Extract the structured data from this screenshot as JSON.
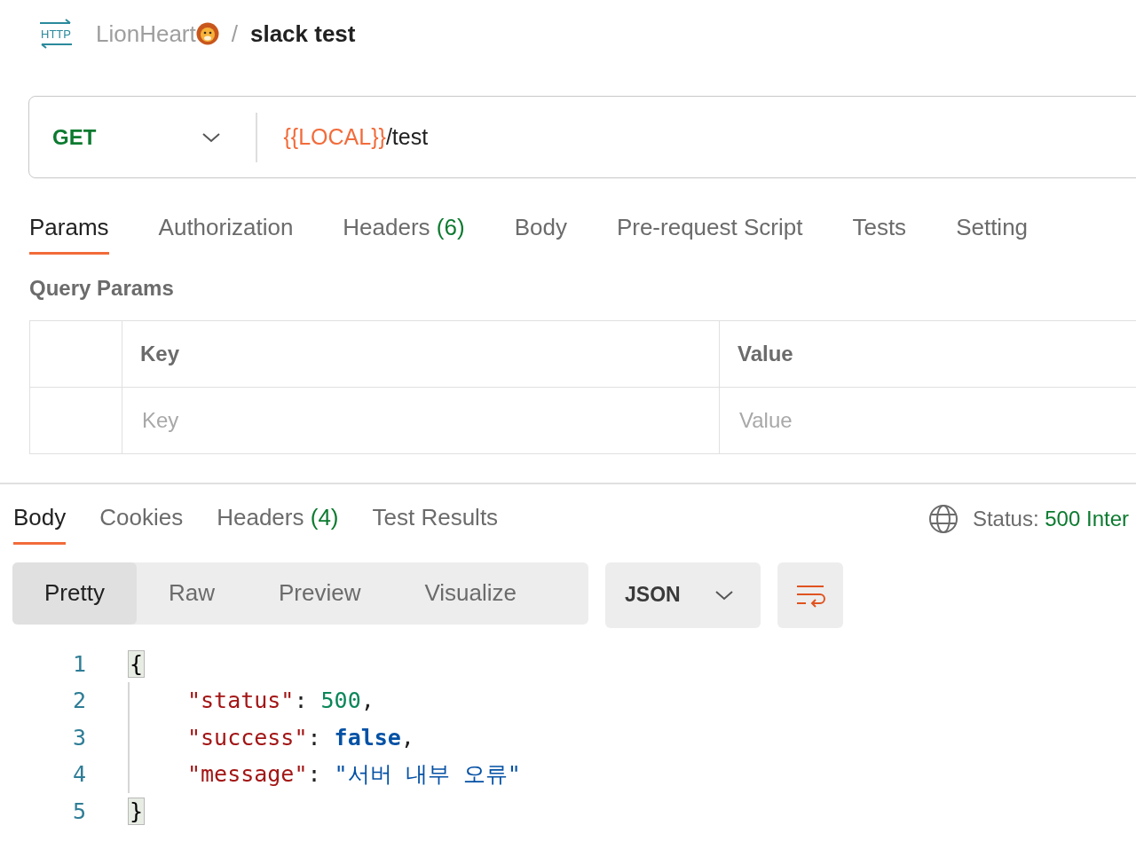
{
  "breadcrumb": {
    "icon_label": "HTTP",
    "workspace": "LionHeart",
    "separator": "/",
    "request": "slack test"
  },
  "request": {
    "method": "GET",
    "url_variable": "{{LOCAL}}",
    "url_path": "/test"
  },
  "request_tabs": [
    {
      "label": "Params",
      "selected": true
    },
    {
      "label": "Authorization",
      "selected": false
    },
    {
      "label": "Headers",
      "count": "(6)",
      "selected": false
    },
    {
      "label": "Body",
      "selected": false
    },
    {
      "label": "Pre-request Script",
      "selected": false
    },
    {
      "label": "Tests",
      "selected": false
    },
    {
      "label": "Setting",
      "selected": false
    }
  ],
  "query_params": {
    "title": "Query Params",
    "columns": [
      "Key",
      "Value"
    ],
    "placeholders": [
      "Key",
      "Value"
    ]
  },
  "response_tabs": [
    {
      "label": "Body",
      "selected": true
    },
    {
      "label": "Cookies",
      "selected": false
    },
    {
      "label": "Headers",
      "count": "(4)",
      "selected": false
    },
    {
      "label": "Test Results",
      "selected": false
    }
  ],
  "status": {
    "label": "Status:",
    "value": "500 Inter"
  },
  "view_modes": [
    {
      "label": "Pretty",
      "selected": true
    },
    {
      "label": "Raw",
      "selected": false
    },
    {
      "label": "Preview",
      "selected": false
    },
    {
      "label": "Visualize",
      "selected": false
    }
  ],
  "format": "JSON",
  "code_lines": [
    {
      "number": "1",
      "kind": "brace",
      "tokens": [
        {
          "kind": "brace",
          "text": "{"
        }
      ]
    },
    {
      "number": "2",
      "kind": "entry",
      "tokens": [
        {
          "kind": "key",
          "text": "\"status\""
        },
        {
          "kind": "punct",
          "text": ": "
        },
        {
          "kind": "number",
          "text": "500"
        },
        {
          "kind": "punct",
          "text": ","
        }
      ]
    },
    {
      "number": "3",
      "kind": "entry",
      "tokens": [
        {
          "kind": "key",
          "text": "\"success\""
        },
        {
          "kind": "punct",
          "text": ": "
        },
        {
          "kind": "boolean",
          "text": "false"
        },
        {
          "kind": "punct",
          "text": ","
        }
      ]
    },
    {
      "number": "4",
      "kind": "entry",
      "tokens": [
        {
          "kind": "key",
          "text": "\"message\""
        },
        {
          "kind": "punct",
          "text": ": "
        },
        {
          "kind": "string",
          "text": "\"서버 내부 오류\""
        }
      ]
    },
    {
      "number": "5",
      "kind": "brace",
      "tokens": [
        {
          "kind": "brace",
          "text": "}"
        }
      ]
    }
  ]
}
